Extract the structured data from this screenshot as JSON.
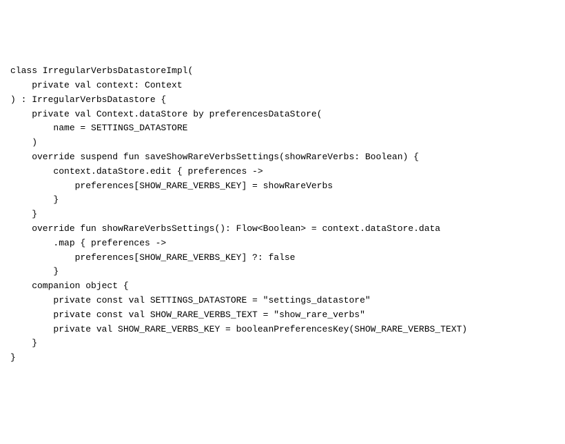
{
  "code": {
    "l1": "class IrregularVerbsDatastoreImpl(",
    "l2": "    private val context: Context",
    "l3": ") : IrregularVerbsDatastore {",
    "l4": "",
    "l5": "    private val Context.dataStore by preferencesDataStore(",
    "l6": "        name = SETTINGS_DATASTORE",
    "l7": "    )",
    "l8": "",
    "l9": "    override suspend fun saveShowRareVerbsSettings(showRareVerbs: Boolean) {",
    "l10": "        context.dataStore.edit { preferences ->",
    "l11": "            preferences[SHOW_RARE_VERBS_KEY] = showRareVerbs",
    "l12": "        }",
    "l13": "    }",
    "l14": "",
    "l15": "    override fun showRareVerbsSettings(): Flow<Boolean> = context.dataStore.data",
    "l16": "        .map { preferences ->",
    "l17": "            preferences[SHOW_RARE_VERBS_KEY] ?: false",
    "l18": "        }",
    "l19": "",
    "l20": "    companion object {",
    "l21": "        private const val SETTINGS_DATASTORE = \"settings_datastore\"",
    "l22": "        private const val SHOW_RARE_VERBS_TEXT = \"show_rare_verbs\"",
    "l23": "        private val SHOW_RARE_VERBS_KEY = booleanPreferencesKey(SHOW_RARE_VERBS_TEXT)",
    "l24": "    }",
    "l25": "}"
  }
}
